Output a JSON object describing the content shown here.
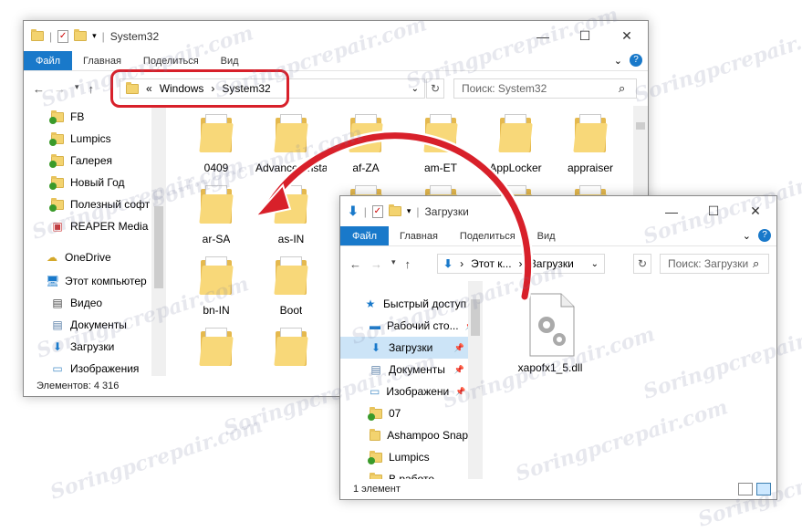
{
  "watermark": "Soringpcrepair.com",
  "window1": {
    "title": "System32",
    "ribbon_tabs": [
      "Файл",
      "Главная",
      "Поделиться",
      "Вид"
    ],
    "breadcrumb": [
      "Windows",
      "System32"
    ],
    "breadcrumb_prefix": "«",
    "search_placeholder": "Поиск: System32",
    "nav_items": [
      {
        "label": "FB",
        "icon": "folder-check-icon"
      },
      {
        "label": "Lumpics",
        "icon": "folder-check-icon"
      },
      {
        "label": "Галерея",
        "icon": "folder-check-icon"
      },
      {
        "label": "Новый Год",
        "icon": "folder-check-icon"
      },
      {
        "label": "Полезный софт",
        "icon": "folder-check-icon"
      },
      {
        "label": "REAPER Media",
        "icon": "reaper-icon"
      },
      {
        "label": "OneDrive",
        "icon": "onedrive-icon"
      },
      {
        "label": "Этот компьютер",
        "icon": "computer-icon"
      },
      {
        "label": "Видео",
        "icon": "video-icon"
      },
      {
        "label": "Документы",
        "icon": "documents-icon"
      },
      {
        "label": "Загрузки",
        "icon": "downloads-icon"
      },
      {
        "label": "Изображения",
        "icon": "images-icon"
      }
    ],
    "files": [
      "0409",
      "AdvancedInstallers",
      "af-ZA",
      "am-ET",
      "AppLocker",
      "appraiser",
      "ar-SA",
      "as-IN",
      "",
      "",
      "",
      "",
      "bn-IN",
      "Boot",
      "",
      "",
      "",
      "",
      "",
      ""
    ],
    "status": "Элементов: 4 316"
  },
  "window2": {
    "title": "Загрузки",
    "ribbon_tabs": [
      "Файл",
      "Главная",
      "Поделиться",
      "Вид"
    ],
    "breadcrumb": [
      "Этот к...",
      "Загрузки"
    ],
    "search_placeholder": "Поиск: Загрузки",
    "nav_items": [
      {
        "label": "Быстрый доступ",
        "icon": "star-icon",
        "pin": false
      },
      {
        "label": "Рабочий сто...",
        "icon": "desktop-icon",
        "pin": true
      },
      {
        "label": "Загрузки",
        "icon": "downloads-icon",
        "pin": true,
        "selected": true
      },
      {
        "label": "Документы",
        "icon": "documents-icon",
        "pin": true
      },
      {
        "label": "Изображени",
        "icon": "images-icon",
        "pin": true
      },
      {
        "label": "07",
        "icon": "folder-check-icon",
        "pin": false
      },
      {
        "label": "Ashampoo Snap",
        "icon": "folder-icon",
        "pin": false
      },
      {
        "label": "Lumpics",
        "icon": "folder-check-icon",
        "pin": false
      },
      {
        "label": "В работе",
        "icon": "folder-check-icon",
        "pin": false
      }
    ],
    "file": "xapofx1_5.dll",
    "status": "1 элемент"
  },
  "colors": {
    "accent": "#1979ca",
    "highlight": "#d8202a",
    "folder": "#f8d879"
  }
}
